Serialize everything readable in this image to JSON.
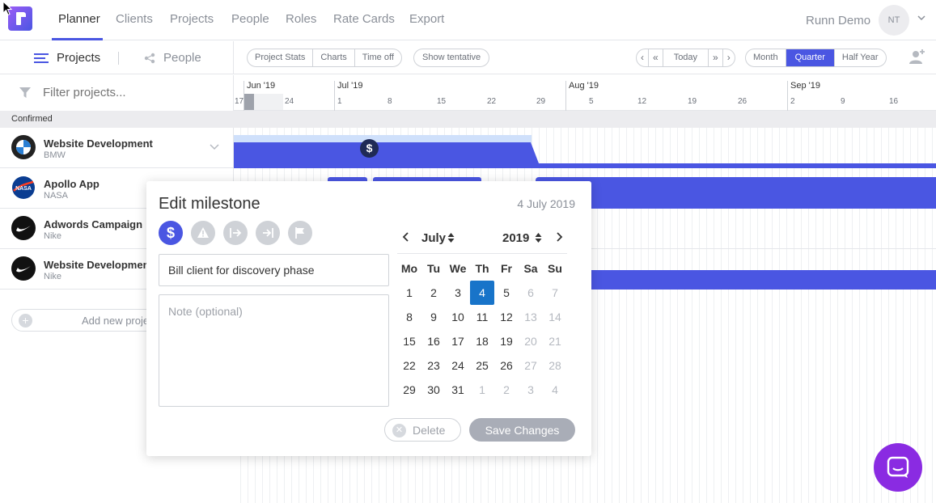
{
  "nav": {
    "items": [
      "Planner",
      "Clients",
      "Projects",
      "People",
      "Roles",
      "Rate Cards",
      "Export"
    ],
    "active_index": 0,
    "user_name": "Runn Demo",
    "avatar_initials": "NT"
  },
  "toolbar": {
    "tab_projects": "Projects",
    "tab_people": "People",
    "view_buttons": [
      "Project Stats",
      "Charts",
      "Time off"
    ],
    "show_tentative": "Show tentative",
    "today": "Today",
    "ranges": [
      "Month",
      "Quarter",
      "Half Year"
    ],
    "selected_range": "Quarter"
  },
  "filter": {
    "placeholder": "Filter projects..."
  },
  "group_header": "Confirmed",
  "projects": [
    {
      "name": "Website Development",
      "client": "BMW",
      "logo": "bmw-logo"
    },
    {
      "name": "Apollo App",
      "client": "NASA",
      "logo": "nasa-logo"
    },
    {
      "name": "Adwords Campaign",
      "client": "Nike",
      "logo": "nike-logo"
    },
    {
      "name": "Website Development",
      "client": "Nike",
      "logo": "nike-logo"
    }
  ],
  "add_project": "Add new proje",
  "timeline": {
    "months": [
      "Jun '19",
      "Jul '19",
      "Aug '19",
      "Sep '19"
    ],
    "days": [
      "17",
      "24",
      "1",
      "8",
      "15",
      "22",
      "29",
      "5",
      "12",
      "19",
      "26",
      "2",
      "9",
      "16"
    ]
  },
  "modal": {
    "title": "Edit milestone",
    "date": "4 July 2019",
    "icons": [
      "dollar-icon",
      "warning-icon",
      "arrow-right-start-icon",
      "arrow-right-end-icon",
      "flag-icon"
    ],
    "selected_icon": "dollar-icon",
    "name_value": "Bill client for discovery phase",
    "note_placeholder": "Note (optional)",
    "calendar": {
      "month": "July",
      "year": "2019",
      "weekdays": [
        "Mo",
        "Tu",
        "We",
        "Th",
        "Fr",
        "Sa",
        "Su"
      ],
      "days": [
        [
          "1",
          "2",
          "3",
          "4",
          "5",
          "6",
          "7"
        ],
        [
          "8",
          "9",
          "10",
          "11",
          "12",
          "13",
          "14"
        ],
        [
          "15",
          "16",
          "17",
          "18",
          "19",
          "20",
          "21"
        ],
        [
          "22",
          "23",
          "24",
          "25",
          "26",
          "27",
          "28"
        ],
        [
          "29",
          "30",
          "31",
          "1",
          "2",
          "3",
          "4"
        ]
      ],
      "selected_day": "4"
    },
    "delete_label": "Delete",
    "save_label": "Save Changes"
  },
  "colors": {
    "accent": "#4a56e2",
    "selected_day": "#1874c9",
    "milestone": "#1f2a56",
    "chat": "#8a2be2"
  }
}
